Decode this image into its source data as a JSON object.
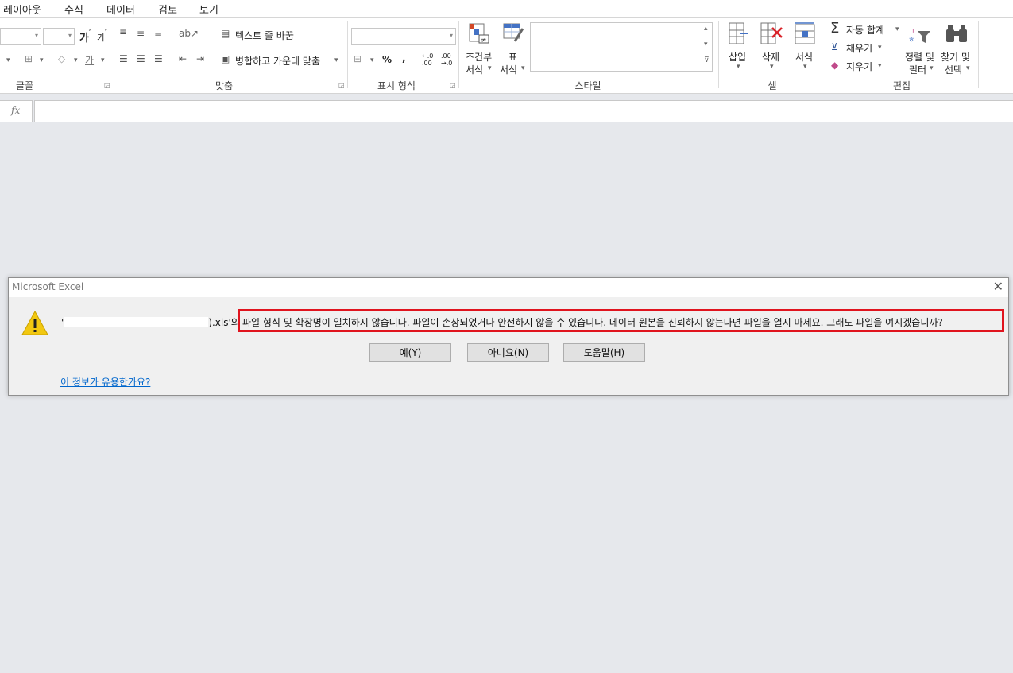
{
  "menu": {
    "tabs": [
      "레이아웃",
      "수식",
      "데이터",
      "검토",
      "보기"
    ]
  },
  "ribbon": {
    "font_group": {
      "label": "글꼴",
      "increase_font": "가",
      "decrease_font": "가",
      "font_color_char": "가"
    },
    "alignment_group": {
      "label": "맞춤",
      "wrap_text": "텍스트 줄 바꿈",
      "merge_center": "병합하고 가운데 맞춤"
    },
    "number_group": {
      "label": "표시 형식",
      "percent": "%",
      "comma": ",",
      "inc_decimal_top": "←.0",
      "inc_decimal_bottom": ".00",
      "dec_decimal_top": ".00",
      "dec_decimal_bottom": "→.0"
    },
    "styles_group": {
      "label": "스타일",
      "conditional_formatting_1": "조건부",
      "conditional_formatting_2": "서식",
      "format_table_1": "표",
      "format_table_2": "서식"
    },
    "cells_group": {
      "label": "셀",
      "insert": "삽입",
      "delete": "삭제",
      "format": "서식"
    },
    "editing_group": {
      "label": "편집",
      "autosum": "자동 합계",
      "fill": "채우기",
      "clear": "지우기",
      "sort_filter_1": "정렬 및",
      "sort_filter_2": "필터",
      "find_select_1": "찾기 및",
      "find_select_2": "선택"
    }
  },
  "formula_bar": {
    "fx": "fx",
    "value": ""
  },
  "dialog": {
    "title": "Microsoft Excel",
    "message_prefix": "'",
    "message_file_suffix": ").xls'의",
    "message_highlighted": "파일 형식 및 확장명이 일치하지 않습니다. 파일이 손상되었거나 안전하지 않을 수 있습니다. 데이터 원본을 신뢰하지 않는다면 파일을 열지 마세요. 그래도 파일을 여시겠습니까?",
    "buttons": {
      "yes": "예(Y)",
      "no": "아니요(N)",
      "help": "도움말(H)"
    },
    "help_link": "이 정보가 유용한가요?",
    "highlight_color": "#e0141e",
    "warning_icon_color": "#f2c811"
  }
}
